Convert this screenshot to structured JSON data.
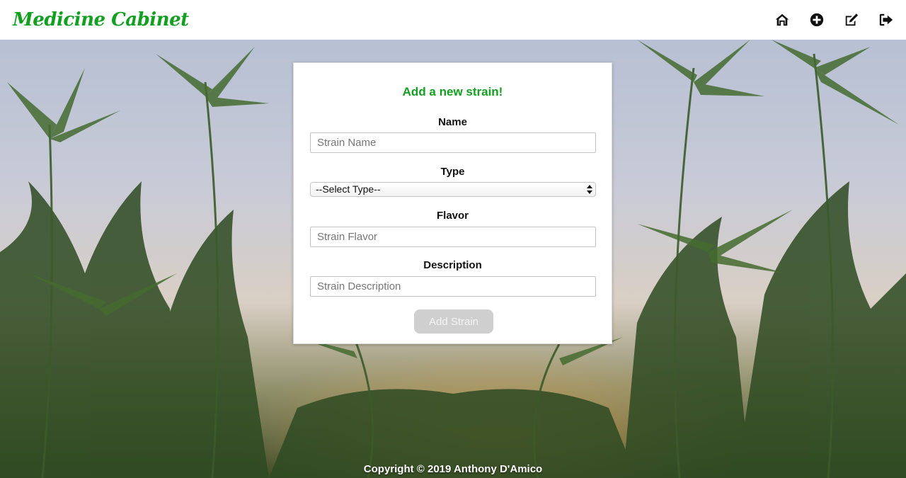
{
  "app": {
    "brand": "Medicine Cabinet"
  },
  "nav": {
    "icons": [
      "home-icon",
      "plus-circle-icon",
      "edit-icon",
      "sign-out-icon"
    ]
  },
  "form": {
    "title": "Add a new strain!",
    "name_label": "Name",
    "name_placeholder": "Strain Name",
    "type_label": "Type",
    "type_selected": "--Select Type--",
    "flavor_label": "Flavor",
    "flavor_placeholder": "Strain Flavor",
    "description_label": "Description",
    "description_placeholder": "Strain Description",
    "submit_label": "Add Strain"
  },
  "footer": {
    "text": "Copyright © 2019 Anthony D'Amico"
  },
  "colors": {
    "brand": "#13a020",
    "button_disabled": "#cfcfcf"
  }
}
